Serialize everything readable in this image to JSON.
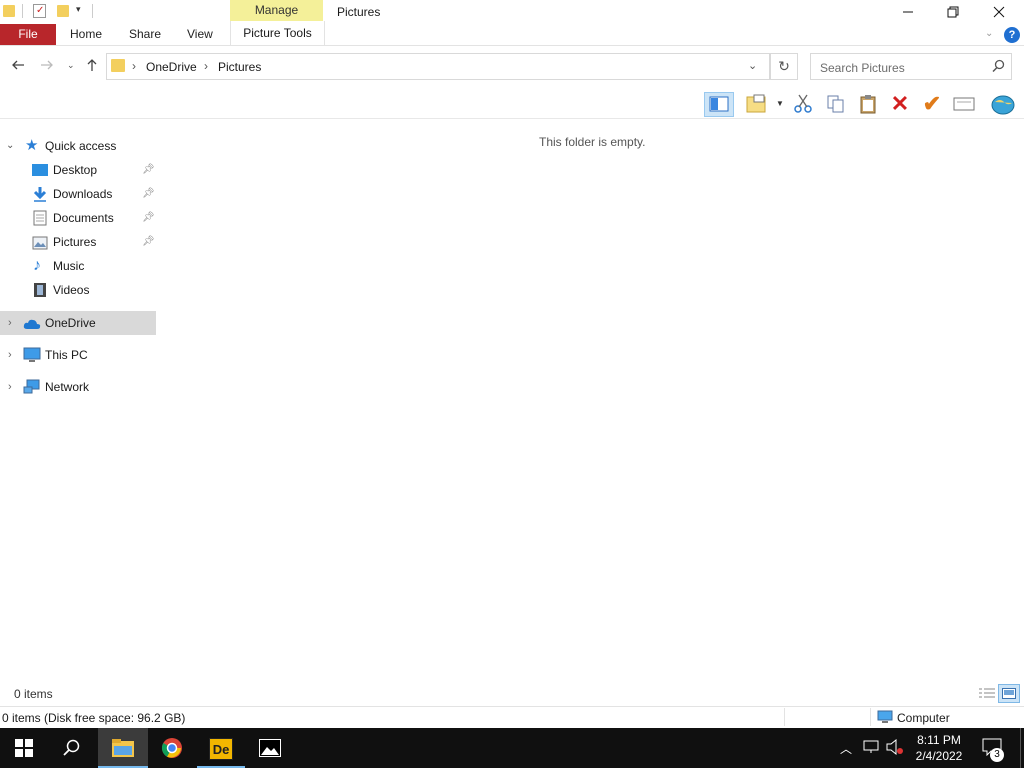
{
  "window": {
    "title": "Pictures",
    "contextual_tab_group": "Manage"
  },
  "ribbon": {
    "tabs": [
      "File",
      "Home",
      "Share",
      "View",
      "Picture Tools"
    ]
  },
  "address": {
    "segments": [
      "OneDrive",
      "Pictures"
    ]
  },
  "search": {
    "placeholder": "Search Pictures"
  },
  "content": {
    "empty_message": "This folder is empty."
  },
  "nav": {
    "quick_access": "Quick access",
    "pinned": [
      {
        "label": "Desktop",
        "icon": "desktop-icon"
      },
      {
        "label": "Downloads",
        "icon": "download-arrow-icon"
      },
      {
        "label": "Documents",
        "icon": "document-icon"
      },
      {
        "label": "Pictures",
        "icon": "pictures-icon"
      }
    ],
    "unpinned": [
      {
        "label": "Music",
        "icon": "music-note-icon"
      },
      {
        "label": "Videos",
        "icon": "film-icon"
      }
    ],
    "onedrive": "OneDrive",
    "this_pc": "This PC",
    "network": "Network"
  },
  "status": {
    "item_count": "0 items",
    "info": "0 items (Disk free space: 96.2 GB)",
    "location": "Computer"
  },
  "taskbar": {
    "time": "8:11 PM",
    "date": "2/4/2022",
    "notification_count": "3",
    "app_label": "De"
  },
  "colors": {
    "file_tab": "#b8262b",
    "manage_tab": "#f4f099",
    "taskbar": "#101010",
    "selection": "#d9d9d9"
  }
}
